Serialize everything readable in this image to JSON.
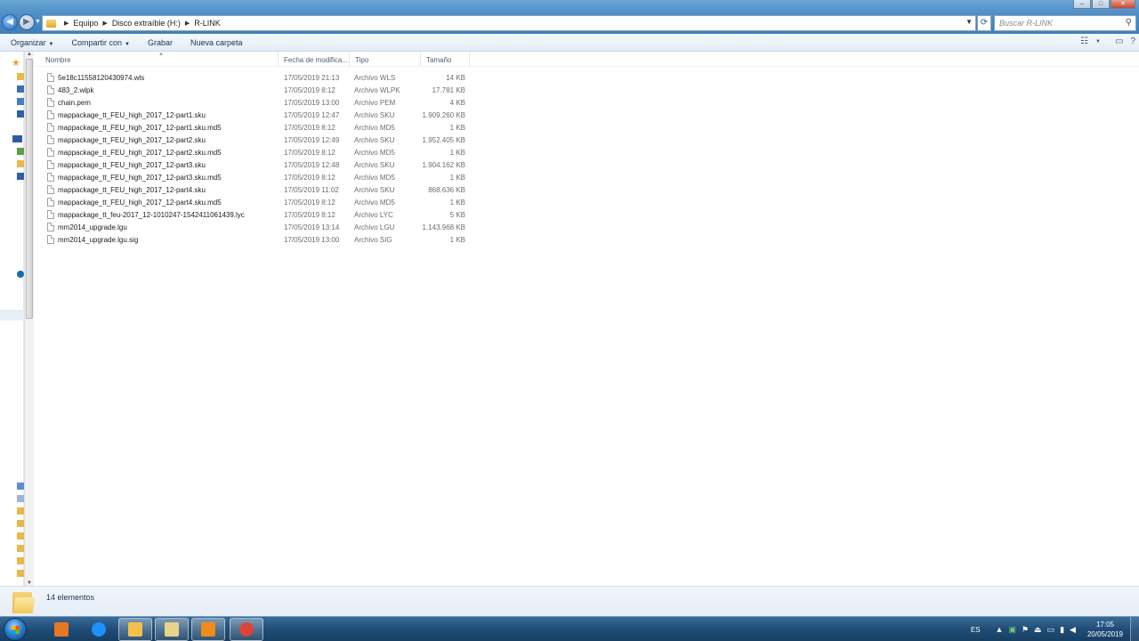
{
  "window": {
    "controls": {
      "minimize": "–",
      "maximize": "□",
      "close": "✕"
    }
  },
  "address": {
    "breadcrumbs": [
      "Equipo",
      "Disco extraíble (H:)",
      "R-LINK"
    ],
    "search_placeholder": "Buscar R-LINK"
  },
  "toolbar": {
    "organize": "Organizar",
    "share": "Compartir con",
    "burn": "Grabar",
    "new_folder": "Nueva carpeta"
  },
  "columns": {
    "name": "Nombre",
    "date": "Fecha de modifica...",
    "type": "Tipo",
    "size": "Tamaño"
  },
  "files": [
    {
      "name": "5e18c11558120430974.wls",
      "date": "17/05/2019 21:13",
      "type": "Archivo WLS",
      "size": "14 KB"
    },
    {
      "name": "483_2.wlpk",
      "date": "17/05/2019 8:12",
      "type": "Archivo WLPK",
      "size": "17.781 KB"
    },
    {
      "name": "chain.pem",
      "date": "17/05/2019 13:00",
      "type": "Archivo PEM",
      "size": "4 KB"
    },
    {
      "name": "mappackage_tt_FEU_high_2017_12-part1.sku",
      "date": "17/05/2019 12:47",
      "type": "Archivo SKU",
      "size": "1.909.260 KB"
    },
    {
      "name": "mappackage_tt_FEU_high_2017_12-part1.sku.md5",
      "date": "17/05/2019 8:12",
      "type": "Archivo MD5",
      "size": "1 KB"
    },
    {
      "name": "mappackage_tt_FEU_high_2017_12-part2.sku",
      "date": "17/05/2019 12:49",
      "type": "Archivo SKU",
      "size": "1.952.405 KB"
    },
    {
      "name": "mappackage_tt_FEU_high_2017_12-part2.sku.md5",
      "date": "17/05/2019 8:12",
      "type": "Archivo MD5",
      "size": "1 KB"
    },
    {
      "name": "mappackage_tt_FEU_high_2017_12-part3.sku",
      "date": "17/05/2019 12:48",
      "type": "Archivo SKU",
      "size": "1.904.162 KB"
    },
    {
      "name": "mappackage_tt_FEU_high_2017_12-part3.sku.md5",
      "date": "17/05/2019 8:12",
      "type": "Archivo MD5",
      "size": "1 KB"
    },
    {
      "name": "mappackage_tt_FEU_high_2017_12-part4.sku",
      "date": "17/05/2019 11:02",
      "type": "Archivo SKU",
      "size": "868.636 KB"
    },
    {
      "name": "mappackage_tt_FEU_high_2017_12-part4.sku.md5",
      "date": "17/05/2019 8:12",
      "type": "Archivo MD5",
      "size": "1 KB"
    },
    {
      "name": "mappackage_tt_feu-2017_12-1010247-1542411061439.lyc",
      "date": "17/05/2019 8:12",
      "type": "Archivo LYC",
      "size": "5 KB"
    },
    {
      "name": "mm2014_upgrade.lgu",
      "date": "17/05/2019 13:14",
      "type": "Archivo LGU",
      "size": "1.143.968 KB"
    },
    {
      "name": "mm2014_upgrade.lgu.sig",
      "date": "17/05/2019 13:00",
      "type": "Archivo SIG",
      "size": "1 KB"
    }
  ],
  "status": {
    "item_count": "14 elementos"
  },
  "taskbar": {
    "apps": [
      {
        "id": "media-player-icon",
        "color": "#e87722"
      },
      {
        "id": "internet-explorer-icon",
        "color": "#1e90ff"
      },
      {
        "id": "explorer-folder-icon",
        "color": "#f3c14b"
      },
      {
        "id": "file-manager-icon",
        "color": "#e9d28a"
      },
      {
        "id": "outlook-icon",
        "color": "#f08c1a"
      },
      {
        "id": "chrome-icon",
        "color": "#db4437"
      }
    ],
    "language": "ES",
    "time": "17:05",
    "date": "20/05/2019"
  },
  "colors": {
    "titlebar": "#4f8fc7",
    "taskbar": "#1f4d77",
    "header_text": "#4c607a"
  }
}
